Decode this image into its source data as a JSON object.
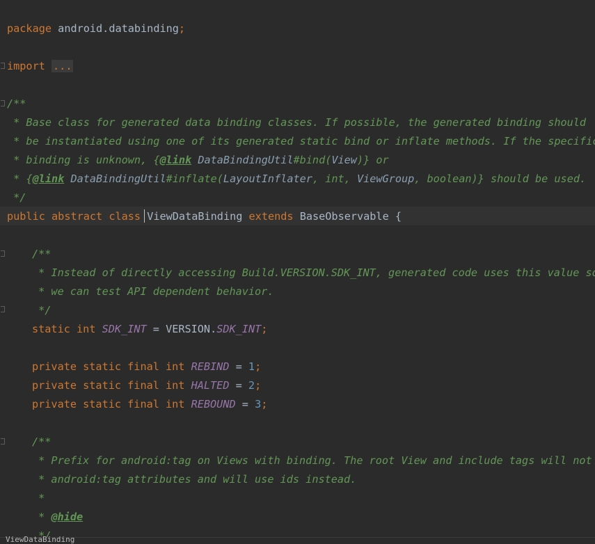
{
  "l1": {
    "kw": "package",
    "name": "android.databinding",
    "semi": ";"
  },
  "l2": {
    "kw": "import",
    "folded": "..."
  },
  "doc1": {
    "open": "/**",
    "a": " * Base class for generated data binding classes. If possible, the generated binding should",
    "b": " * be instantiated using one of its generated static bind or inflate methods. If the specific",
    "c1": " * binding is unknown, ",
    "c_brace": "{",
    "c_tag": "@link",
    "c_ref": " DataBindingUtil",
    "c_method": "#bind(",
    "c_param": "View",
    "c_end": ")} or",
    "d1": " * ",
    "d_brace": "{",
    "d_tag": "@link",
    "d_ref": " DataBindingUtil",
    "d_method": "#inflate(",
    "d_p1": "LayoutInflater",
    "d_s1": ", int, ",
    "d_p2": "ViewGroup",
    "d_s2": ", boolean)} should be used.",
    "close": " */"
  },
  "classdecl": {
    "kw1": "public",
    "kw2": "abstract",
    "kw3": "class",
    "name": "ViewDataBinding",
    "kw4": "extends",
    "base": "BaseObservable",
    "brace": "{"
  },
  "doc2": {
    "open": "/**",
    "a": " * Instead of directly accessing Build.VERSION.SDK_INT, generated code uses this value so",
    "b": " * we can test API dependent behavior.",
    "close": " */"
  },
  "sdk": {
    "kw1": "static",
    "kw2": "int",
    "field": "SDK_INT",
    "eq": " = VERSION.",
    "rhs": "SDK_INT",
    "semi": ";"
  },
  "rebind": {
    "mods": "private static final int",
    "field": "REBIND",
    "eq": " = ",
    "val": "1",
    "semi": ";"
  },
  "halted": {
    "mods": "private static final int",
    "field": "HALTED",
    "eq": " = ",
    "val": "2",
    "semi": ";"
  },
  "rebound": {
    "mods": "private static final int",
    "field": "REBOUND",
    "eq": " = ",
    "val": "3",
    "semi": ";"
  },
  "doc3": {
    "open": "/**",
    "a": " * Prefix for android:tag on Views with binding. The root View and include tags will not h",
    "b": " * android:tag attributes and will use ids instead.",
    "c": " *",
    "d_star": " * ",
    "d_tag": "@hide",
    "e": " */"
  },
  "bottom_tab": "ViewDataBinding"
}
